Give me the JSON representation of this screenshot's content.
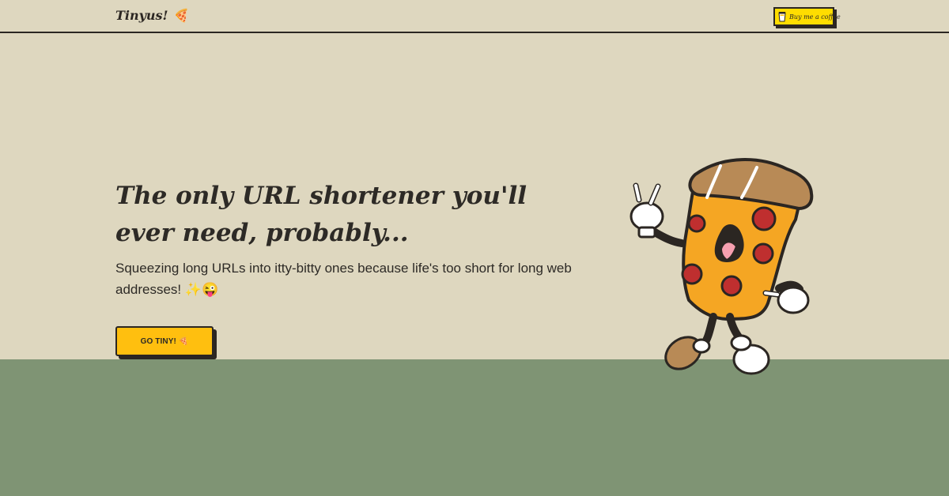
{
  "header": {
    "brand": "Tinyus! 🍕",
    "coffee_button_label": "Buy me a coffee"
  },
  "hero": {
    "title": "The only URL shortener you'll ever need, probably...",
    "subtitle": "Squeezing long URLs into itty-bitty ones because life's too short for long web addresses! ✨😜",
    "cta_label": "GO TINY! 🍕"
  },
  "icons": {
    "brand": "pizza-emoji-icon",
    "coffee": "coffee-cup-icon",
    "mascot": "pizza-mascot-illustration"
  },
  "colors": {
    "background_top": "#ded7bf",
    "background_bottom": "#7f9474",
    "button_yellow": "#ffbf0f",
    "coffee_yellow": "#ffdd00",
    "ink": "#2b2622"
  }
}
